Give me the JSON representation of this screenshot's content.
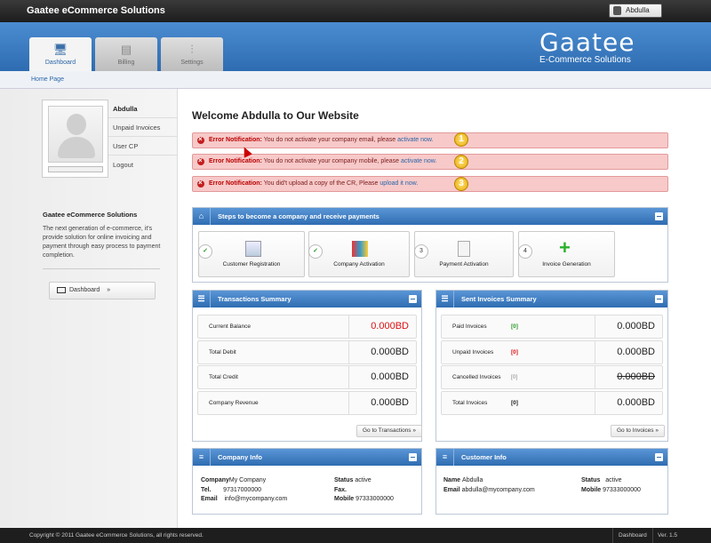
{
  "topbar": {
    "app_title": "Gaatee eCommerce Solutions",
    "user": "Abdulla"
  },
  "tabs": [
    {
      "label": "Dashboard",
      "icon": "monitor-icon",
      "active": true
    },
    {
      "label": "Billing",
      "icon": "cash-register-icon",
      "active": false
    },
    {
      "label": "Settings",
      "icon": "sliders-icon",
      "active": false
    }
  ],
  "logo": {
    "brand": "Gaatee",
    "tagline": "E-Commerce Solutions"
  },
  "breadcrumb": "Home Page",
  "sidebar": {
    "user_name": "Abdulla",
    "menu": [
      "Unpaid Invoices",
      "User CP",
      "Logout"
    ],
    "about_title": "Gaatee eCommerce Solutions",
    "about_text": "The next generation of e-commerce, it's provide solution for online invoicing and payment through easy process to payment completion.",
    "dashboard_button": "Dashboard",
    "dashboard_arrow": "»"
  },
  "welcome": "Welcome Abdulla to Our Website",
  "errors": [
    {
      "label": "Error Notification:",
      "text": "You do not activate your company email, please",
      "link": "activate now.",
      "number": "1"
    },
    {
      "label": "Error Notification:",
      "text": "You do not activate your company mobile, please",
      "link": "activate now.",
      "number": "2"
    },
    {
      "label": "Error Notification:",
      "text": "You did't upload a copy of the CR, Please",
      "link": "upload it now.",
      "number": "3"
    }
  ],
  "steps_panel": {
    "title": "Steps to become a company and receive payments",
    "steps": [
      {
        "marker": "✓",
        "label": "Customer Registration"
      },
      {
        "marker": "✓",
        "label": "Company Activation"
      },
      {
        "marker": "3",
        "label": "Payment Activation"
      },
      {
        "marker": "4",
        "label": "Invoice Generation"
      }
    ]
  },
  "transactions": {
    "title": "Transactions Summary",
    "rows": [
      {
        "label": "Current Balance",
        "value": "0.000BD"
      },
      {
        "label": "Total Debit",
        "value": "0.000BD"
      },
      {
        "label": "Total Credit",
        "value": "0.000BD"
      },
      {
        "label": "Company Revenue",
        "value": "0.000BD"
      }
    ],
    "button": "Go to Transactions »"
  },
  "sent_invoices": {
    "title": "Sent Invoices Summary",
    "rows": [
      {
        "label": "Paid Invoices",
        "count": "[0]",
        "value": "0.000BD"
      },
      {
        "label": "Unpaid Invoices",
        "count": "[0]",
        "value": "0.000BD"
      },
      {
        "label": "Cancelled Invoices",
        "count": "[0]",
        "value": "0.000BD"
      },
      {
        "label": "Total Invoices",
        "count": "[0]",
        "value": "0.000BD"
      }
    ],
    "button": "Go to Invoices »"
  },
  "company_info": {
    "title": "Company Info",
    "company_label": "Company",
    "company_value": "My Company",
    "tel_label": "Tel.",
    "tel_value": "97317000000",
    "email_label": "Email",
    "email_value": "info@mycompany.com",
    "status_label": "Status",
    "status_value": "active",
    "fax_label": "Fax.",
    "fax_value": "",
    "mobile_label": "Mobile",
    "mobile_value": "97333000000"
  },
  "customer_info": {
    "title": "Customer Info",
    "name_label": "Name",
    "name_value": "Abdulla",
    "email_label": "Email",
    "email_value": "abdulla@mycompany.com",
    "status_label": "Status",
    "status_value": "active",
    "mobile_label": "Mobile",
    "mobile_value": "97333000000"
  },
  "footer": {
    "copyright": "Copyright © 2011 Gaatee eCommerce Solutions, all rights reserved.",
    "dashboard": "Dashboard",
    "version": "Ver. 1.5"
  },
  "colors": {
    "accent": "#2f6db2",
    "error_bg": "#f7c9c9",
    "balance_red": "#d11111"
  }
}
